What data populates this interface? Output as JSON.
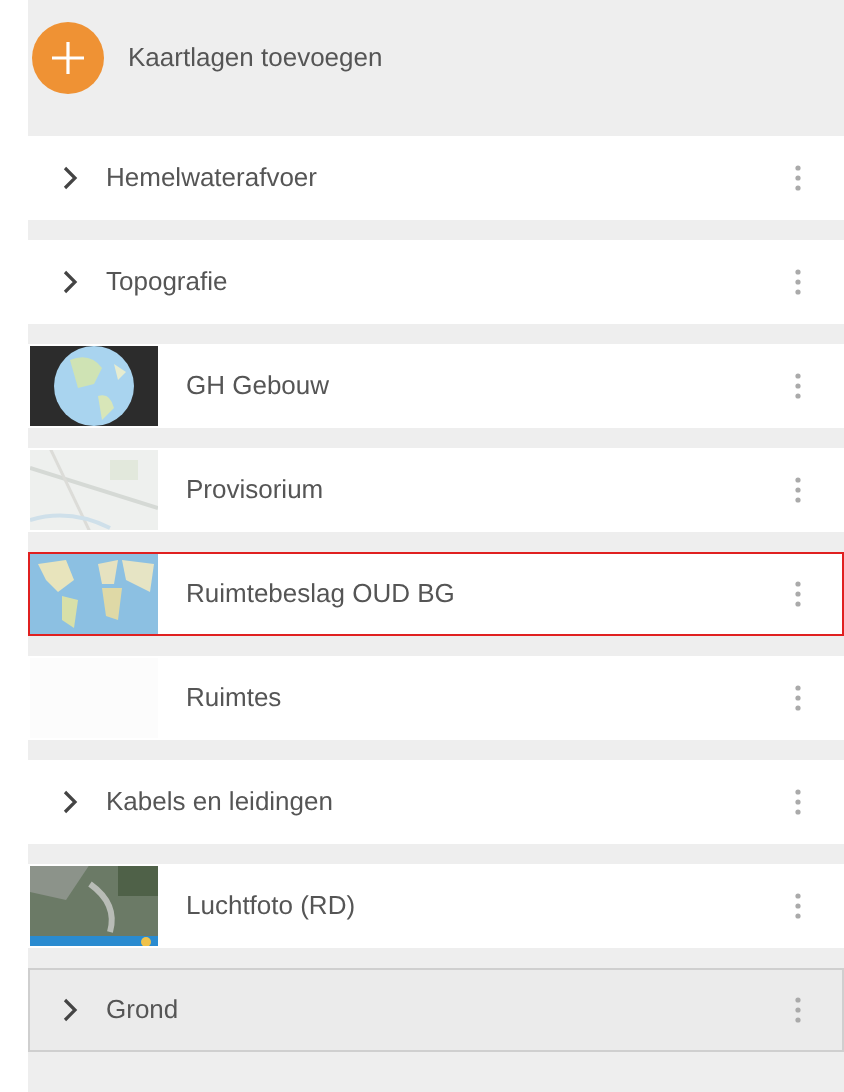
{
  "header": {
    "label": "Kaartlagen toevoegen"
  },
  "layers": [
    {
      "kind": "group",
      "name": "Hemelwaterafvoer",
      "selected": false,
      "hovered": false
    },
    {
      "kind": "group",
      "name": "Topografie",
      "selected": false,
      "hovered": false
    },
    {
      "kind": "layer",
      "name": "GH Gebouw",
      "thumbnail": true,
      "selected": false,
      "hovered": false
    },
    {
      "kind": "layer",
      "name": "Provisorium",
      "thumbnail": true,
      "selected": false,
      "hovered": false
    },
    {
      "kind": "layer",
      "name": "Ruimtebeslag OUD BG",
      "thumbnail": true,
      "selected": true,
      "hovered": false
    },
    {
      "kind": "layer",
      "name": "Ruimtes",
      "thumbnail": false,
      "selected": false,
      "hovered": false
    },
    {
      "kind": "group",
      "name": "Kabels en leidingen",
      "selected": false,
      "hovered": false
    },
    {
      "kind": "layer",
      "name": "Luchtfoto (RD)",
      "thumbnail": true,
      "selected": false,
      "hovered": false
    },
    {
      "kind": "group",
      "name": "Grond",
      "selected": false,
      "hovered": true
    }
  ]
}
